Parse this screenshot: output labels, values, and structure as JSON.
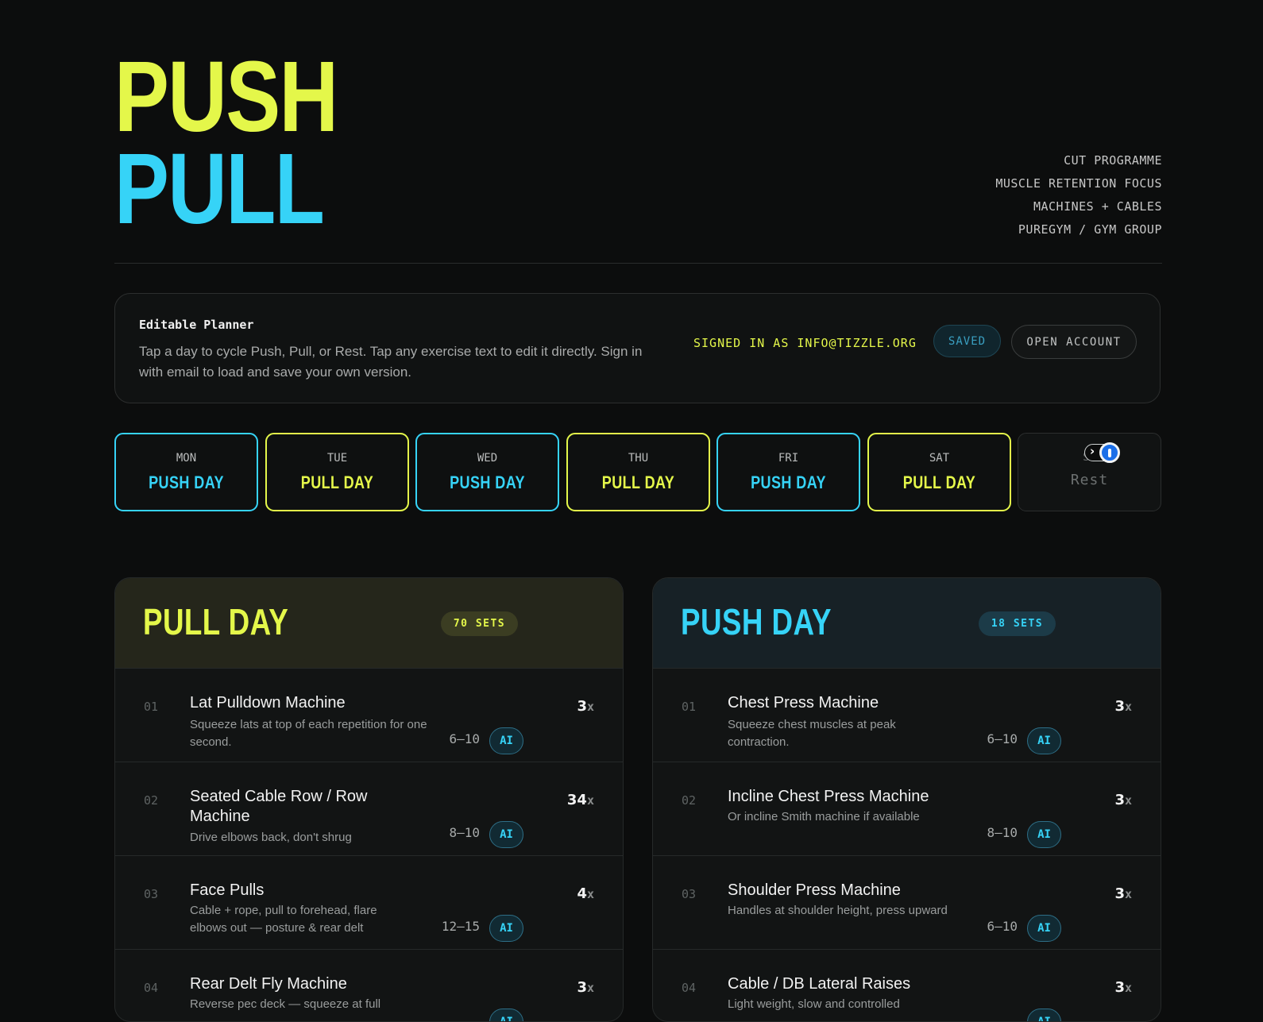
{
  "hero": {
    "line1": "PUSH",
    "line2": "PULL"
  },
  "meta": [
    "CUT PROGRAMME",
    "MUSCLE RETENTION FOCUS",
    "MACHINES + CABLES",
    "PUREGYM / GYM GROUP"
  ],
  "planner": {
    "title": "Editable Planner",
    "description": "Tap a day to cycle Push, Pull, or Rest. Tap any exercise text to edit it directly. Sign in with email to load and save your own version.",
    "signed_in": "SIGNED IN AS INFO@TIZZLE.ORG",
    "saved_label": "SAVED",
    "open_account_label": "OPEN ACCOUNT"
  },
  "days": [
    {
      "name": "MON",
      "type": "PUSH DAY"
    },
    {
      "name": "TUE",
      "type": "PULL DAY"
    },
    {
      "name": "WED",
      "type": "PUSH DAY"
    },
    {
      "name": "THU",
      "type": "PULL DAY"
    },
    {
      "name": "FRI",
      "type": "PUSH DAY"
    },
    {
      "name": "SAT",
      "type": "PULL DAY"
    },
    {
      "name": "SU",
      "type": "Rest"
    }
  ],
  "pull_panel": {
    "title": "PULL DAY",
    "sets": "70 SETS",
    "exercises": [
      {
        "num": "01",
        "name": "Lat Pulldown Machine",
        "desc": "Squeeze lats at top of each repetition for one second.",
        "reps": "6–10",
        "sets": "3",
        "ai": "AI"
      },
      {
        "num": "02",
        "name": "Seated Cable Row / Row Machine",
        "desc": "Drive elbows back, don't shrug",
        "reps": "8–10",
        "sets": "34",
        "ai": "AI"
      },
      {
        "num": "03",
        "name": "Face Pulls",
        "desc": "Cable + rope, pull to forehead, flare elbows out — posture & rear delt",
        "reps": "12–15",
        "sets": "4",
        "ai": "AI"
      },
      {
        "num": "04",
        "name": "Rear Delt Fly Machine",
        "desc": "Reverse pec deck — squeeze at full",
        "reps": "",
        "sets": "3",
        "ai": "AI"
      }
    ]
  },
  "push_panel": {
    "title": "PUSH DAY",
    "sets": "18 SETS",
    "exercises": [
      {
        "num": "01",
        "name": "Chest Press Machine",
        "desc": "Squeeze chest muscles at peak contraction.",
        "reps": "6–10",
        "sets": "3",
        "ai": "AI"
      },
      {
        "num": "02",
        "name": "Incline Chest Press Machine",
        "desc": "Or incline Smith machine if available",
        "reps": "8–10",
        "sets": "3",
        "ai": "AI"
      },
      {
        "num": "03",
        "name": "Shoulder Press Machine",
        "desc": "Handles at shoulder height, press upward",
        "reps": "6–10",
        "sets": "3",
        "ai": "AI"
      },
      {
        "num": "04",
        "name": "Cable / DB Lateral Raises",
        "desc": "Light weight, slow and controlled",
        "reps": "",
        "sets": "3",
        "ai": "AI"
      }
    ]
  },
  "multiplier": "x",
  "colors": {
    "push": "#36d3f7",
    "pull": "#e4f74a",
    "background": "#0c0d0d"
  }
}
